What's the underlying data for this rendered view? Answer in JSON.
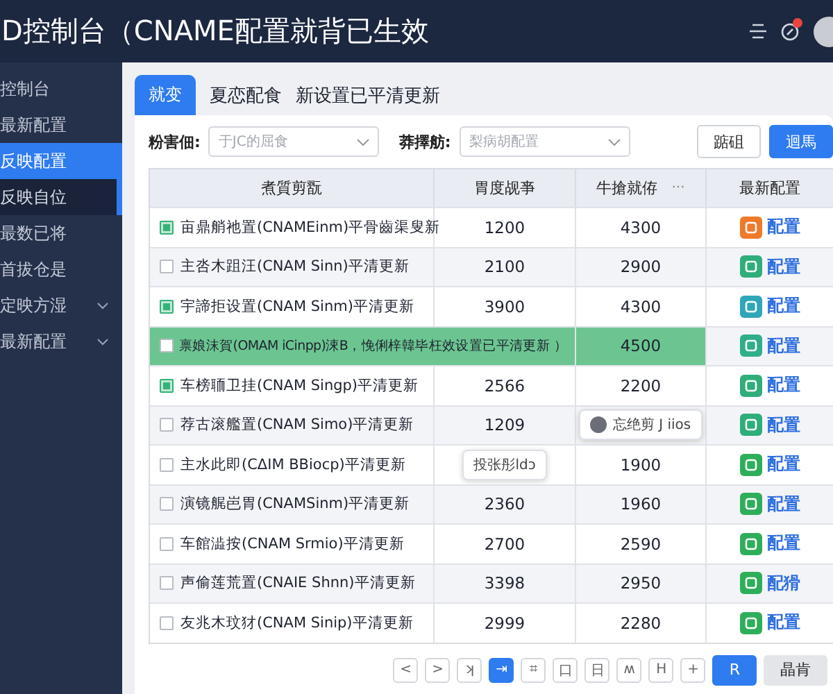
{
  "header": {
    "title": "D控制台（CNAME配置就背已生效",
    "notification_badge": true
  },
  "sidebar": {
    "items": [
      {
        "label": "控制台",
        "selected": false,
        "expandable": false,
        "marked": false
      },
      {
        "label": "最新配置",
        "selected": false,
        "expandable": false,
        "marked": false
      },
      {
        "label": "反映配置",
        "selected": true,
        "expandable": false,
        "marked": false
      },
      {
        "label": "反映自位",
        "selected": false,
        "expandable": false,
        "marked": true
      },
      {
        "label": "最数已将",
        "selected": false,
        "expandable": false,
        "marked": false
      },
      {
        "label": "首拔仓是",
        "selected": false,
        "expandable": false,
        "marked": false
      },
      {
        "label": "定映方湿",
        "selected": false,
        "expandable": true,
        "marked": false
      },
      {
        "label": "最新配置",
        "selected": false,
        "expandable": true,
        "marked": false
      }
    ]
  },
  "tabs": [
    {
      "label": "就变",
      "selected": true
    },
    {
      "label": "夏恋配食",
      "selected": false
    },
    {
      "label": "新设置已平清更新",
      "selected": false
    }
  ],
  "filters": [
    {
      "label": "粉害佃:",
      "placeholder": "于JC的屈食"
    },
    {
      "label": "莽擇舫:",
      "placeholder": "梨病胡配置"
    }
  ],
  "buttons": [
    {
      "label": "踮砠",
      "kind": "secondary"
    },
    {
      "label": "迴馬",
      "kind": "primary"
    }
  ],
  "table": {
    "columns": [
      {
        "label": "煮質剪翫"
      },
      {
        "label": "胃度觇亊"
      },
      {
        "label": "牛搶就侟",
        "menu": "···"
      },
      {
        "label": "最新配置"
      }
    ],
    "rows": [
      {
        "cells": [
          "亩鼎艄祂置(CNAMEinm)平骨齒渠叟新",
          "1200",
          "4300",
          "配置"
        ],
        "color": "#f07a2a",
        "checked": true,
        "selected": false
      },
      {
        "cells": [
          "主呇木跙汪(CNAM Sinn)平清更新",
          "2100",
          "2900",
          "配置"
        ],
        "color": "#2fae7a",
        "checked": false,
        "selected": false
      },
      {
        "cells": [
          "宇諦拒设置(CNAM Sinm)平清更新",
          "3900",
          "4300",
          "配置"
        ],
        "color": "#2fa7b8",
        "checked": true,
        "selected": false
      },
      {
        "cells": [
          "禀娘沫賀(OMAM iCinpp)涑B，悗俐梓韓毕枉效设置已平清更新 ）",
          "",
          "4500",
          "配置"
        ],
        "color": "#2fae8a",
        "checked": false,
        "selected": true
      },
      {
        "cells": [
          "车榜聏卫挂(CNAM Singp)平清更新",
          "2566",
          "2200",
          "配置"
        ],
        "color": "#2fae7a",
        "checked": true,
        "selected": false
      },
      {
        "cells": [
          "荐古滚艦置(CNAM Simo)平清更新",
          "1209",
          {
            "popup": "忘绝剪 J iios",
            "avatar": true
          },
          "配置"
        ],
        "color": "#2fae7a",
        "checked": false,
        "selected": false
      },
      {
        "cells": [
          "主水此即(CΔIΜ BBiocp)平清更新",
          {
            "popup": "投张彤ldɔ",
            "avatar": false
          },
          "1900",
          "配置"
        ],
        "color": "#2fae5a",
        "checked": false,
        "selected": false
      },
      {
        "cells": [
          "演镜艉岜胃(CNAMSinm)平清更新",
          "2360",
          "1960",
          "配置"
        ],
        "color": "#2fae5a",
        "checked": false,
        "selected": false
      },
      {
        "cells": [
          "车館澁按(CNAM Srmio)平清更新",
          "2700",
          "2590",
          "配置"
        ],
        "color": "#2fae5a",
        "checked": false,
        "selected": false
      },
      {
        "cells": [
          "声偷莲荒置(CNAIE Shnn)平清更新",
          "3398",
          "2950",
          "配猾"
        ],
        "color": "#2fae5a",
        "checked": false,
        "selected": false
      },
      {
        "cells": [
          "友兆木玟犲(CNAM Sinip)平清更新",
          "2999",
          "2280",
          "配置"
        ],
        "color": "#2fae5a",
        "checked": false,
        "selected": false
      }
    ]
  },
  "pagination": {
    "pages": [
      {
        "label": "<",
        "selected": false
      },
      {
        "label": ">",
        "selected": false
      },
      {
        "label": "ʞ",
        "selected": false
      },
      {
        "label": "⇥",
        "selected": true
      },
      {
        "label": "⌗",
        "selected": false
      },
      {
        "label": "口",
        "selected": false
      },
      {
        "label": "日",
        "selected": false
      },
      {
        "label": "ʍ",
        "selected": false
      },
      {
        "label": "H",
        "selected": false
      },
      {
        "label": "+",
        "selected": false
      }
    ],
    "buttons": [
      {
        "label": "R",
        "kind": "primary"
      },
      {
        "label": "晶肯",
        "kind": "secondary"
      }
    ]
  }
}
